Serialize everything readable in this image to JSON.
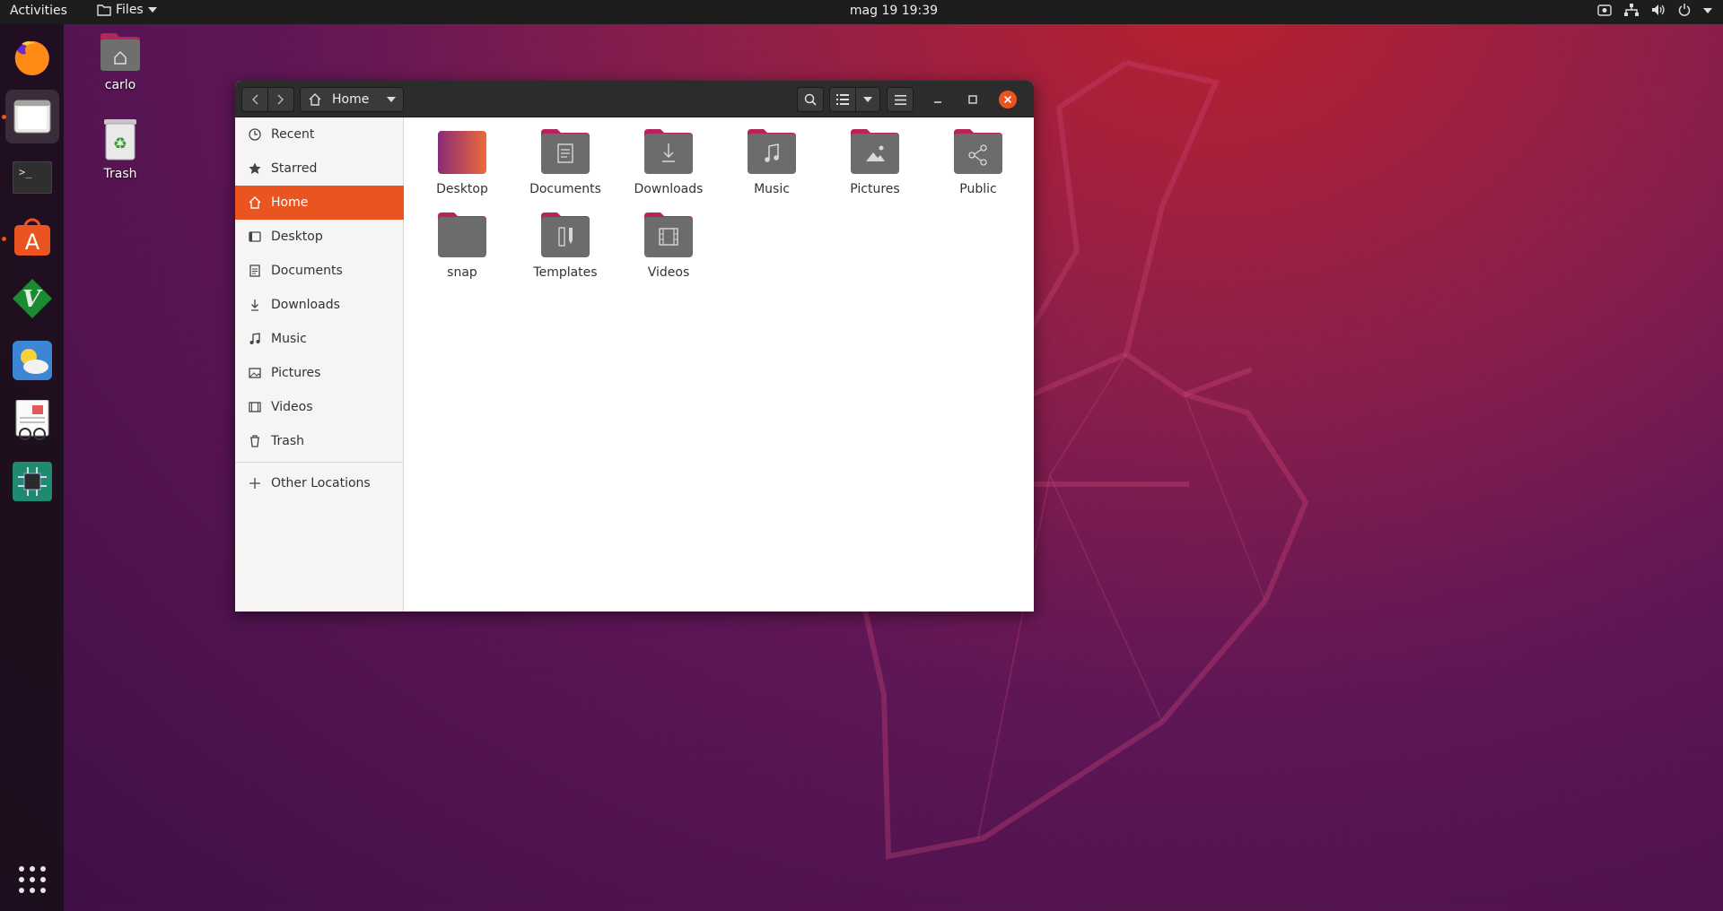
{
  "topbar": {
    "activities": "Activities",
    "app_menu": "Files",
    "clock": "mag 19  19:39"
  },
  "desktop": {
    "icons": [
      {
        "label": "carlo"
      },
      {
        "label": "Trash"
      }
    ]
  },
  "window": {
    "path_label": "Home",
    "sidebar": {
      "items": [
        {
          "label": "Recent",
          "icon": "clock-icon"
        },
        {
          "label": "Starred",
          "icon": "star-icon"
        },
        {
          "label": "Home",
          "icon": "home-icon"
        },
        {
          "label": "Desktop",
          "icon": "desktop-icon"
        },
        {
          "label": "Documents",
          "icon": "document-icon"
        },
        {
          "label": "Downloads",
          "icon": "download-icon"
        },
        {
          "label": "Music",
          "icon": "music-icon"
        },
        {
          "label": "Pictures",
          "icon": "picture-icon"
        },
        {
          "label": "Videos",
          "icon": "video-icon"
        },
        {
          "label": "Trash",
          "icon": "trash-icon"
        }
      ],
      "selected": "Home",
      "other_locations": "Other Locations"
    },
    "folders": [
      {
        "label": "Desktop",
        "icon": "desktop-folder-icon"
      },
      {
        "label": "Documents",
        "icon": "documents-folder-icon"
      },
      {
        "label": "Downloads",
        "icon": "downloads-folder-icon"
      },
      {
        "label": "Music",
        "icon": "music-folder-icon"
      },
      {
        "label": "Pictures",
        "icon": "pictures-folder-icon"
      },
      {
        "label": "Public",
        "icon": "public-folder-icon"
      },
      {
        "label": "snap",
        "icon": "folder-icon"
      },
      {
        "label": "Templates",
        "icon": "templates-folder-icon"
      },
      {
        "label": "Videos",
        "icon": "videos-folder-icon"
      }
    ]
  },
  "colors": {
    "accent": "#e95420",
    "folder_tab": "#b5245a",
    "folder_body": "#6c6c6c",
    "topbar": "#1d1d1d",
    "headerbar": "#2c2c2c"
  }
}
